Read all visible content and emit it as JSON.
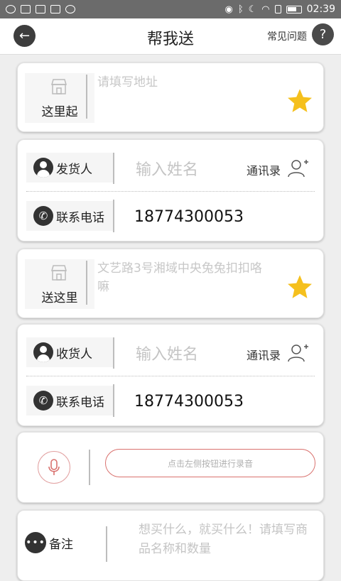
{
  "status_bar": {
    "time": "02:39"
  },
  "header": {
    "title": "帮我送",
    "faq_label": "常见问题",
    "help_glyph": "?"
  },
  "pickup": {
    "label": "这里起",
    "address_placeholder": "请填写地址"
  },
  "sender": {
    "label": "发货人",
    "name_placeholder": "输入姓名",
    "contacts_label": "通讯录",
    "phone_label": "联系电话",
    "phone_value": "18774300053"
  },
  "dropoff": {
    "label": "送这里",
    "address_placeholder": "文艺路3号湘域中央兔兔扣扣咯嘛"
  },
  "receiver": {
    "label": "收货人",
    "name_placeholder": "输入姓名",
    "contacts_label": "通讯录",
    "phone_label": "联系电话",
    "phone_value": "18774300053"
  },
  "voice": {
    "record_label": "点击左侧按钮进行录音"
  },
  "note": {
    "label": "备注",
    "placeholder": "想买什么，就买什么！请填写商品名称和数量"
  },
  "colors": {
    "star": "#f5c01d",
    "accent_red": "#d9716e",
    "icon_dark": "#333333"
  }
}
